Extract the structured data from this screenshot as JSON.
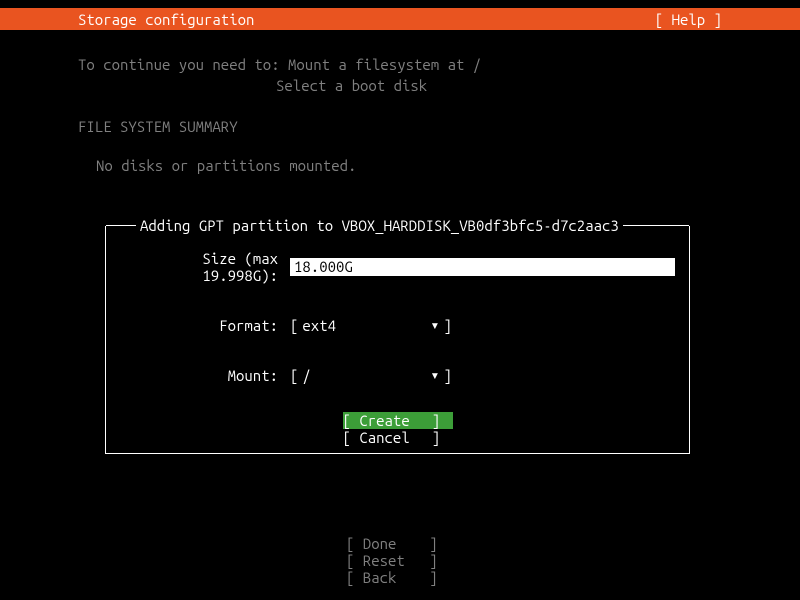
{
  "header": {
    "title": "Storage configuration",
    "help": "[ Help ]"
  },
  "continue": {
    "line1": "To continue you need to: Mount a filesystem at /",
    "line2": "Select a boot disk"
  },
  "section": {
    "summary_header": "FILE SYSTEM SUMMARY",
    "no_disks": "No disks or partitions mounted."
  },
  "dialog": {
    "title": "Adding GPT partition to VBOX_HARDDISK_VB0df3bfc5-d7c2aac3",
    "size_label": "Size (max 19.998G):",
    "size_value": "18.000G",
    "format_label": "Format:",
    "format_value": "ext4",
    "mount_label": "Mount:",
    "mount_value": "/",
    "arrow": "▾",
    "create": "Create",
    "cancel": "Cancel"
  },
  "bottom": {
    "done": "Done",
    "reset": "Reset",
    "back": "Back"
  }
}
